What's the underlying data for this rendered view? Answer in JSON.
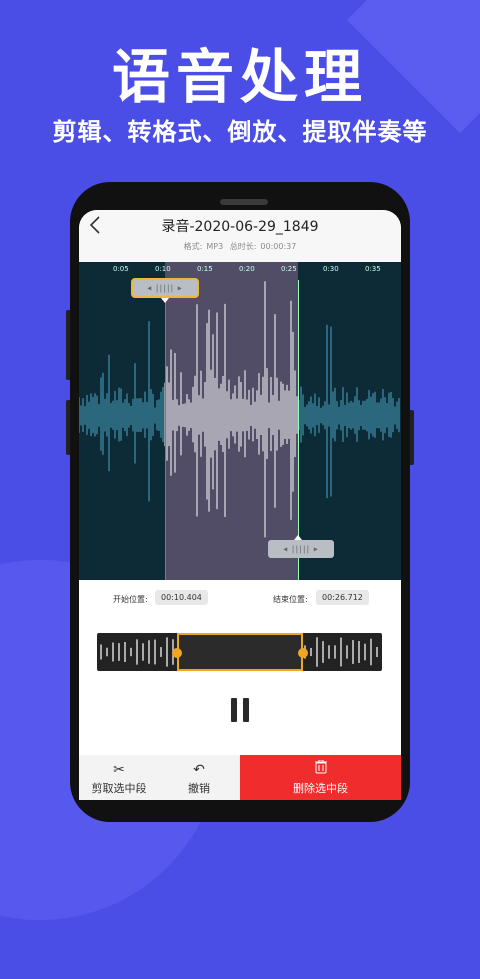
{
  "promo": {
    "headline": "语音处理",
    "subline": "剪辑、转格式、倒放、提取伴奏等"
  },
  "header": {
    "back_icon": "chevron-left-icon",
    "title": "录音-2020-06-29_1849",
    "format_label": "格式:",
    "format_value": "MP3",
    "duration_label": "总时长:",
    "duration_value": "00:00:37"
  },
  "timeline": {
    "ticks": [
      "0:05",
      "0:10",
      "0:15",
      "0:20",
      "0:25",
      "0:30",
      "0:35"
    ]
  },
  "selection": {
    "start_label": "开始位置:",
    "start_value": "00:10.404",
    "end_label": "结束位置:",
    "end_value": "00:26.712"
  },
  "toolbar": {
    "cut_icon": "scissors-icon",
    "cut_label": "剪取选中段",
    "undo_icon": "undo-icon",
    "undo_label": "撤销",
    "delete_icon": "trash-icon",
    "delete_label": "删除选中段"
  },
  "colors": {
    "background": "#4b4ee6",
    "accent": "#f0a623",
    "delete": "#f02c2c",
    "wave_outside": "#4aa6c4",
    "wave_selected": "#ffffff"
  }
}
